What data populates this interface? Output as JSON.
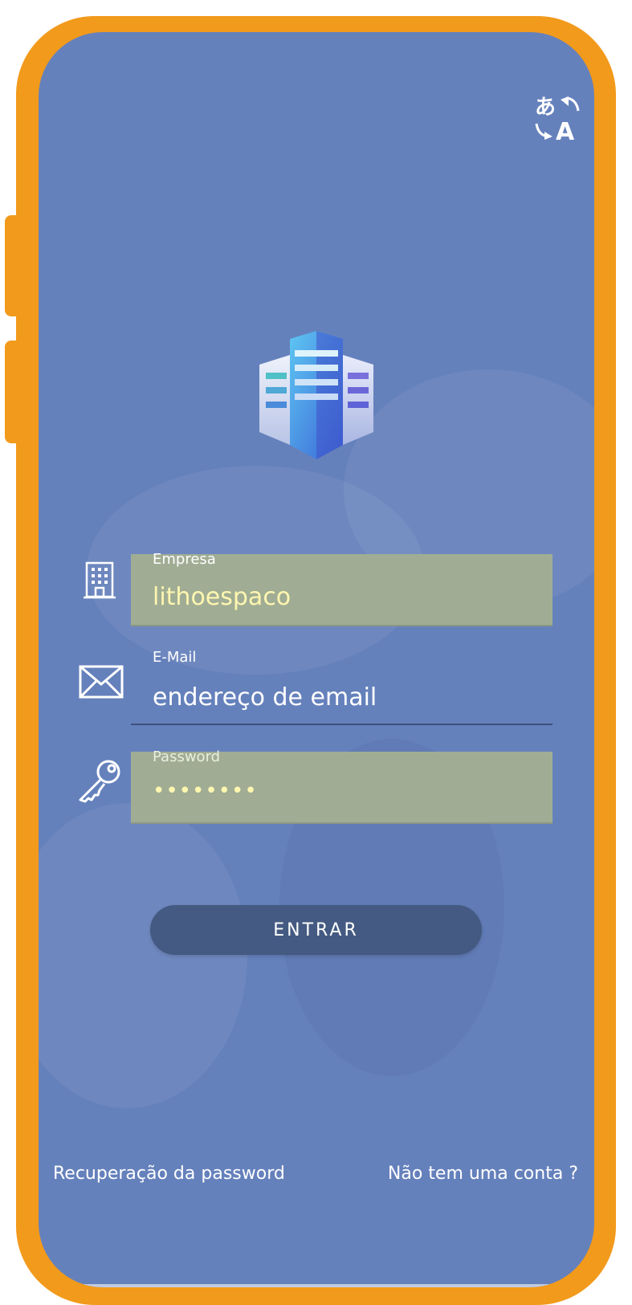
{
  "form": {
    "company": {
      "label": "Empresa",
      "value": "lithoespaco"
    },
    "email": {
      "label": "E-Mail",
      "placeholder": "endereço de email"
    },
    "password": {
      "label": "Password",
      "value": "••••••••"
    }
  },
  "login_button_label": "ENTRAR",
  "footer": {
    "recover_password": "Recuperação da password",
    "no_account": "Não tem uma conta ?"
  },
  "icons": {
    "translate": "translate-icon",
    "logo": "building-logo",
    "company": "building-icon",
    "email": "envelope-icon",
    "password": "key-icon"
  },
  "colors": {
    "frame": "#f29a1b",
    "screen_bg": "#6581bc",
    "autofill_bg": "#a0ad94",
    "autofill_text": "#fff6b0",
    "button_bg": "#445a82"
  }
}
